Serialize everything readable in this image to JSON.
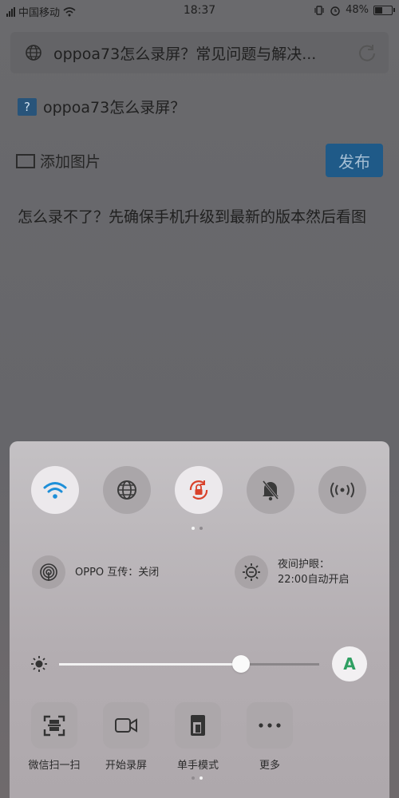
{
  "status_bar": {
    "carrier": "中国移动",
    "time": "18:37",
    "battery": "48%"
  },
  "search": {
    "title": "oppoa73怎么录屏？常见问题与解决..."
  },
  "page": {
    "question": "oppoa73怎么录屏？",
    "question_icon": "?",
    "add_image_label": "添加图片",
    "publish_label": "发布",
    "answer_text": "怎么录不了？先确保手机升级到最新的版本然后看图"
  },
  "control_panel": {
    "toggles": [
      {
        "icon": "wifi-icon",
        "state": "on"
      },
      {
        "icon": "globe-icon",
        "state": "off"
      },
      {
        "icon": "rotation-lock-icon",
        "state": "on"
      },
      {
        "icon": "bell-mute-icon",
        "state": "off"
      },
      {
        "icon": "hotspot-icon",
        "state": "off"
      }
    ],
    "oppo_share": "OPPO 互传：关闭",
    "night_mode_line1": "夜间护眼：",
    "night_mode_line2": "22:00自动开启",
    "brightness": 0.7,
    "auto_brightness_label": "A",
    "shortcuts": [
      {
        "label": "微信扫一扫",
        "icon": "scan-icon"
      },
      {
        "label": "开始录屏",
        "icon": "video-camera-icon"
      },
      {
        "label": "单手模式",
        "icon": "one-hand-icon"
      },
      {
        "label": "更多",
        "icon": "more-icon"
      }
    ]
  },
  "colors": {
    "wifi_blue": "#1e8fd8",
    "rotation_lock_red": "#d9422b",
    "auto_green": "#2f9f62",
    "publish_blue": "#1f5a88"
  }
}
